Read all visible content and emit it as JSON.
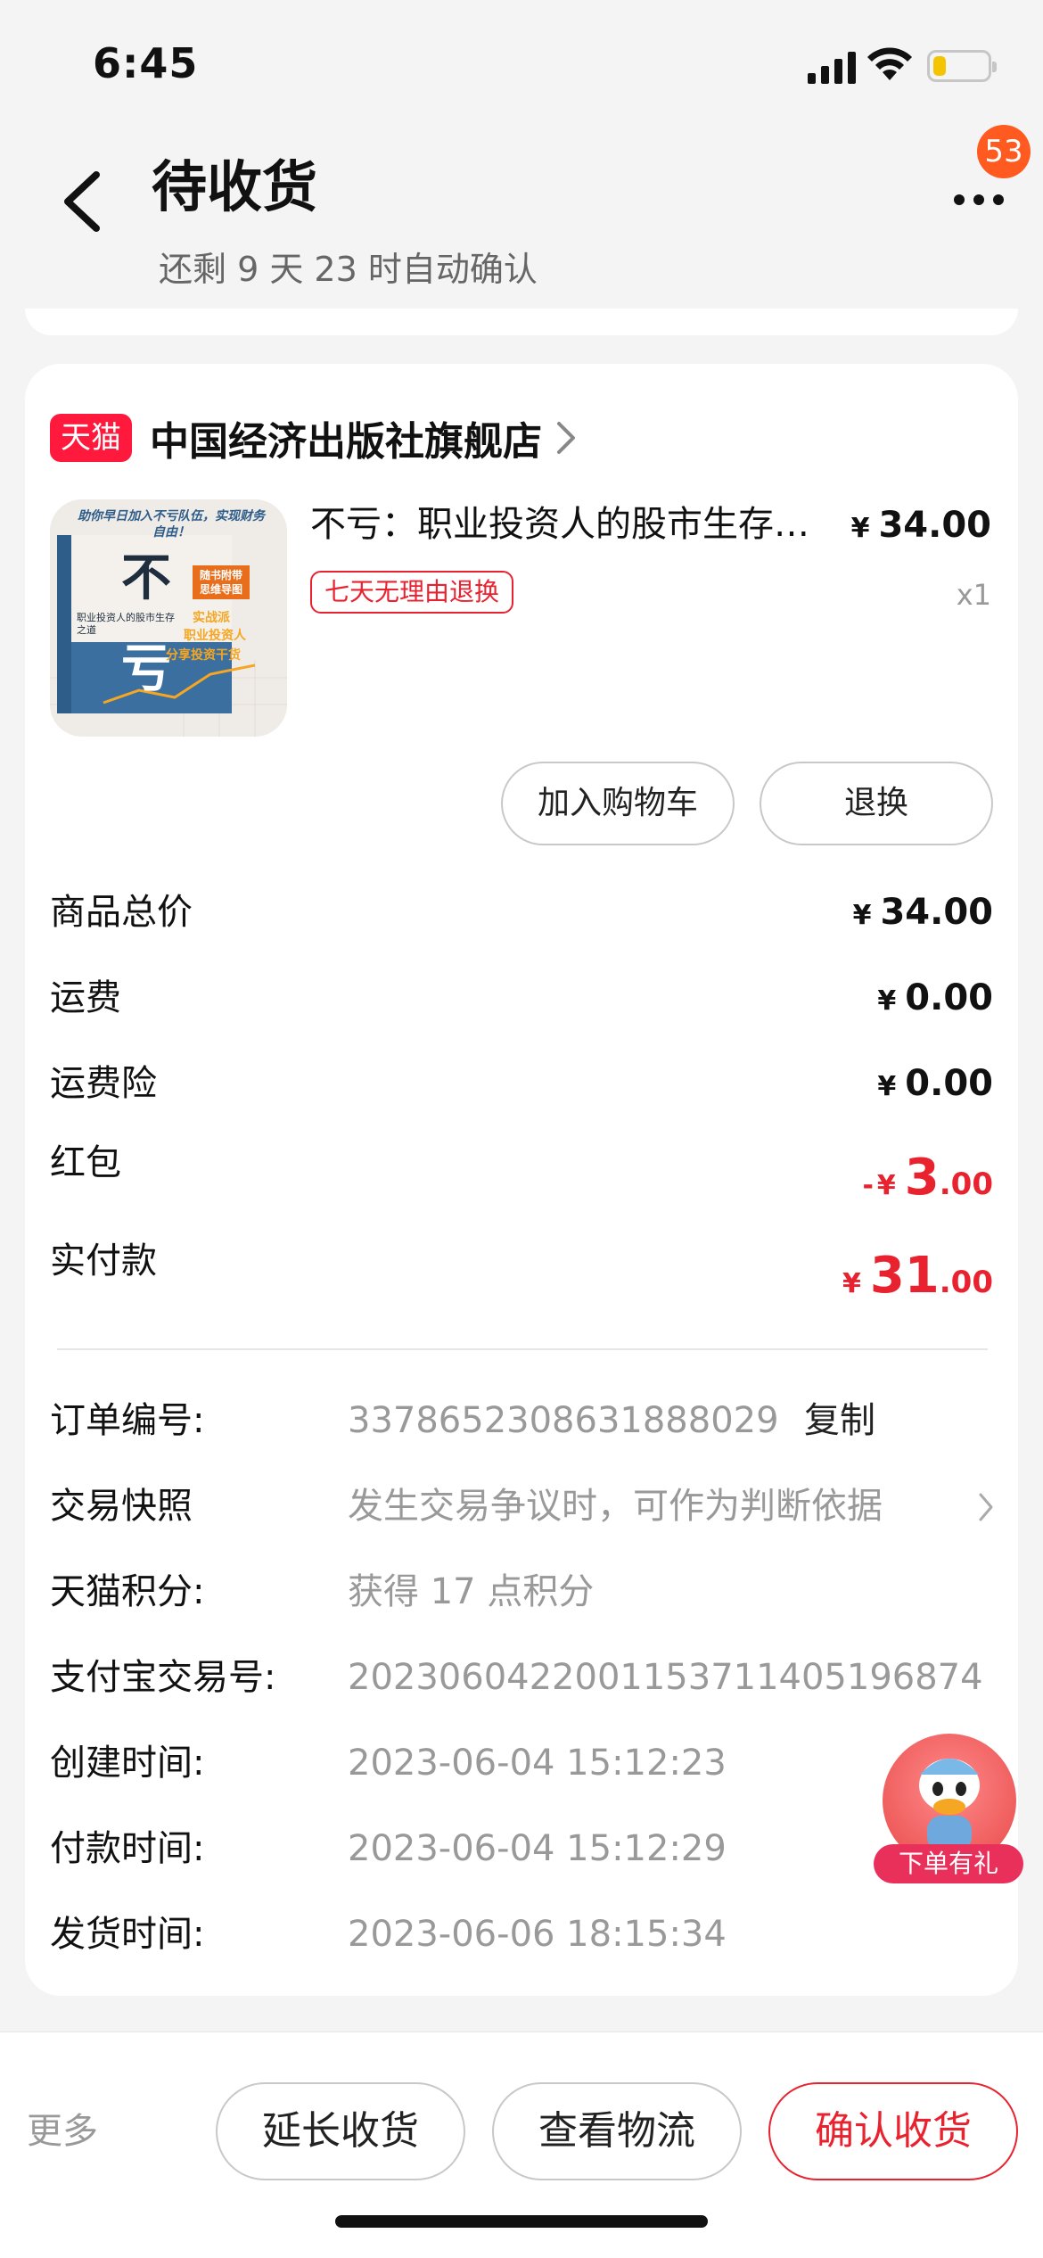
{
  "status_bar": {
    "time": "6:45"
  },
  "header": {
    "title": "待收货",
    "subtitle": "还剩 9 天 23 时自动确认",
    "badge_count": "53"
  },
  "store": {
    "tag": "天猫",
    "name": "中国经济出版社旗舰店"
  },
  "product": {
    "title": "不亏：职业投资人的股市生存之道",
    "price_symbol": "¥",
    "price": "34.00",
    "quantity": "x1",
    "return_tag": "七天无理由退换",
    "cover": {
      "banner": "助你早日加入不亏队伍，实现财务自由！",
      "big_char_1": "不",
      "big_char_2": "亏",
      "subtitle": "职业投资人的股市生存之道",
      "sticker": "随书附带思维导图",
      "slogan_1": "实战派",
      "slogan_2": "职业投资人",
      "slogan_3": "分享投资干货"
    }
  },
  "actions": {
    "add_cart": "加入购物车",
    "exchange": "退换"
  },
  "fees": [
    {
      "label": "商品总价",
      "symbol": "¥",
      "value": "34.00"
    },
    {
      "label": "运费",
      "symbol": "¥",
      "value": "0.00"
    },
    {
      "label": "运费险",
      "symbol": "¥",
      "value": "0.00"
    }
  ],
  "red_packet": {
    "label": "红包",
    "prefix": "-",
    "symbol": "¥",
    "int": "3",
    "dec": ".00"
  },
  "paid": {
    "label": "实付款",
    "symbol": "¥",
    "int": "31",
    "dec": ".00"
  },
  "info": {
    "order_no": {
      "label": "订单编号:",
      "value": "3378652308631888029",
      "action": "复制"
    },
    "snapshot": {
      "label": "交易快照",
      "value": "发生交易争议时，可作为判断依据"
    },
    "points": {
      "label": "天猫积分:",
      "value": "获得 17 点积分"
    },
    "alipay": {
      "label": "支付宝交易号:",
      "value": "2023060422001153711405196874"
    },
    "created": {
      "label": "创建时间:",
      "value": "2023-06-04 15:12:23"
    },
    "paid_time": {
      "label": "付款时间:",
      "value": "2023-06-04 15:12:29"
    },
    "shipped": {
      "label": "发货时间:",
      "value": "2023-06-06 18:15:34"
    }
  },
  "promo": {
    "label": "下单有礼"
  },
  "bottom": {
    "more": "更多",
    "extend": "延长收货",
    "logistics": "查看物流",
    "confirm": "确认收货"
  },
  "colors": {
    "accent": "#e8232f",
    "tmall": "#ff1a3d",
    "badge": "#ff5a1f"
  }
}
